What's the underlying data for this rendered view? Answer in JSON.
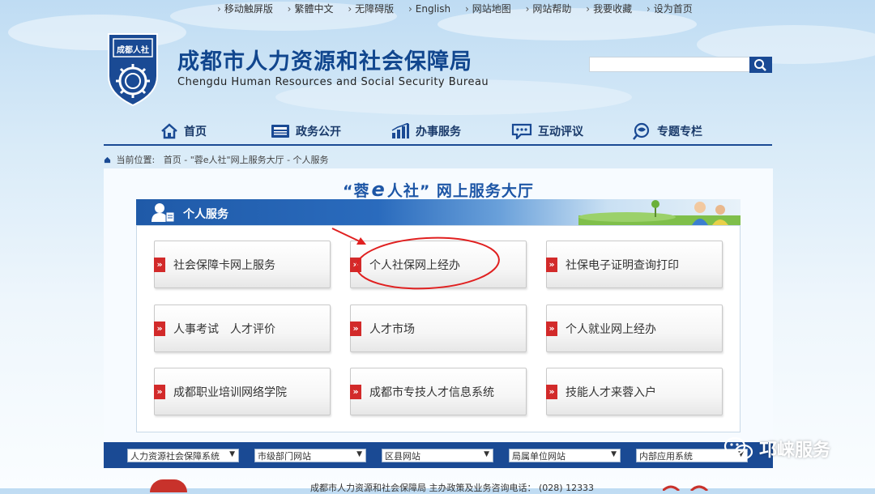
{
  "topbar": {
    "links": [
      "移动触屏版",
      "繁體中文",
      "无障碍版",
      "English",
      "网站地图",
      "网站帮助",
      "我要收藏",
      "设为首页"
    ]
  },
  "header": {
    "logo_text": "成都人社",
    "title_cn": "成都市人力资源和社会保障局",
    "title_en": "Chengdu Human Resources and Social Security Bureau"
  },
  "search": {
    "placeholder": ""
  },
  "nav": {
    "items": [
      {
        "label": "首页",
        "icon": "home-icon"
      },
      {
        "label": "政务公开",
        "icon": "newspaper-icon"
      },
      {
        "label": "办事服务",
        "icon": "bar-chart-icon"
      },
      {
        "label": "互动评议",
        "icon": "chat-icon"
      },
      {
        "label": "专题专栏",
        "icon": "search-globe-icon"
      }
    ]
  },
  "breadcrumb": {
    "prefix": "当前位置:",
    "items": [
      "首页",
      "\"蓉e人社\"网上服务大厅",
      "个人服务"
    ],
    "sep": " - "
  },
  "hall": {
    "title_left": "“蓉",
    "title_e": "e",
    "title_right": "人社” 网上服务大厅"
  },
  "section": {
    "label": "个人服务"
  },
  "services": [
    "社会保障卡网上服务",
    "个人社保网上经办",
    "社保电子证明查询打印",
    "人事考试　人才评价",
    "人才市场",
    "个人就业网上经办",
    "成都职业培训网络学院",
    "成都市专技人才信息系统",
    "技能人才来蓉入户"
  ],
  "bottom_selects": [
    "人力资源社会保障系统",
    "市级部门网站",
    "区县网站",
    "局属单位网站",
    "内部应用系统"
  ],
  "footer": {
    "text": "成都市人力资源和社会保障局 主办政策及业务咨询电话： (028) 12333"
  },
  "watermark": {
    "text": "邛崃服务"
  },
  "colors": {
    "brand_blue": "#1a4a94",
    "accent_red": "#d22a2a",
    "annotation_red": "#e02020"
  }
}
